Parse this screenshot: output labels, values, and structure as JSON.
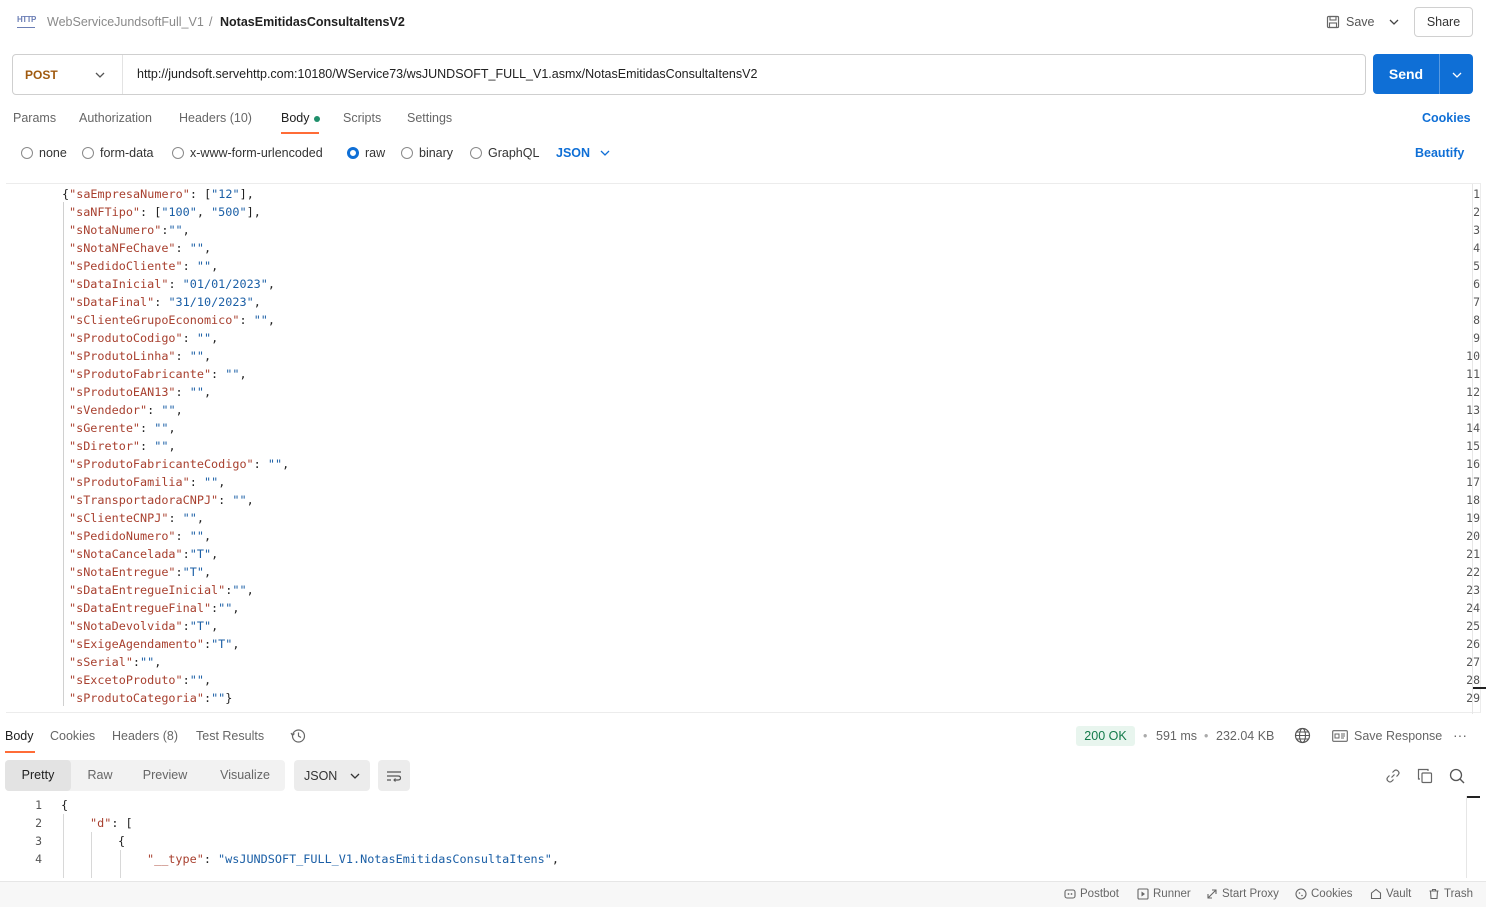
{
  "header": {
    "protocol_badge": "HTTP",
    "collection": "WebServiceJundsoftFull_V1",
    "separator": "/",
    "request_name": "NotasEmitidasConsultaItensV2",
    "save_label": "Save",
    "share_label": "Share"
  },
  "request": {
    "method": "POST",
    "url": "http://jundsoft.servehttp.com:10180/WService73/wsJUNDSOFT_FULL_V1.asmx/NotasEmitidasConsultaItensV2",
    "send_label": "Send",
    "tabs": [
      "Params",
      "Authorization",
      "Headers (10)",
      "Body",
      "Scripts",
      "Settings"
    ],
    "active_tab": "Body",
    "cookies_label": "Cookies",
    "body_types": [
      "none",
      "form-data",
      "x-www-form-urlencoded",
      "raw",
      "binary",
      "GraphQL"
    ],
    "selected_body_type": "raw",
    "raw_format": "JSON",
    "beautify_label": "Beautify"
  },
  "editor": {
    "lines": [
      [
        [
          "p",
          "{"
        ],
        [
          "k",
          "\"saEmpresaNumero\""
        ],
        [
          "p",
          ": ["
        ],
        [
          "s",
          "\"12\""
        ],
        [
          "p",
          "],"
        ]
      ],
      [
        [
          "k",
          "\"saNFTipo\""
        ],
        [
          "p",
          ": ["
        ],
        [
          "s",
          "\"100\""
        ],
        [
          "p",
          ", "
        ],
        [
          "s",
          "\"500\""
        ],
        [
          "p",
          "],"
        ]
      ],
      [
        [
          "k",
          "\"sNotaNumero\""
        ],
        [
          "p",
          ":"
        ],
        [
          "s",
          "\"\""
        ],
        [
          "p",
          ","
        ]
      ],
      [
        [
          "k",
          "\"sNotaNFeChave\""
        ],
        [
          "p",
          ": "
        ],
        [
          "s",
          "\"\""
        ],
        [
          "p",
          ","
        ]
      ],
      [
        [
          "k",
          "\"sPedidoCliente\""
        ],
        [
          "p",
          ": "
        ],
        [
          "s",
          "\"\""
        ],
        [
          "p",
          ","
        ]
      ],
      [
        [
          "k",
          "\"sDataInicial\""
        ],
        [
          "p",
          ": "
        ],
        [
          "s",
          "\"01/01/2023\""
        ],
        [
          "p",
          ","
        ]
      ],
      [
        [
          "k",
          "\"sDataFinal\""
        ],
        [
          "p",
          ": "
        ],
        [
          "s",
          "\"31/10/2023\""
        ],
        [
          "p",
          ","
        ]
      ],
      [
        [
          "k",
          "\"sClienteGrupoEconomico\""
        ],
        [
          "p",
          ": "
        ],
        [
          "s",
          "\"\""
        ],
        [
          "p",
          ","
        ]
      ],
      [
        [
          "k",
          "\"sProdutoCodigo\""
        ],
        [
          "p",
          ": "
        ],
        [
          "s",
          "\"\""
        ],
        [
          "p",
          ","
        ]
      ],
      [
        [
          "k",
          "\"sProdutoLinha\""
        ],
        [
          "p",
          ": "
        ],
        [
          "s",
          "\"\""
        ],
        [
          "p",
          ","
        ]
      ],
      [
        [
          "k",
          "\"sProdutoFabricante\""
        ],
        [
          "p",
          ": "
        ],
        [
          "s",
          "\"\""
        ],
        [
          "p",
          ","
        ]
      ],
      [
        [
          "k",
          "\"sProdutoEAN13\""
        ],
        [
          "p",
          ": "
        ],
        [
          "s",
          "\"\""
        ],
        [
          "p",
          ","
        ]
      ],
      [
        [
          "k",
          "\"sVendedor\""
        ],
        [
          "p",
          ": "
        ],
        [
          "s",
          "\"\""
        ],
        [
          "p",
          ","
        ]
      ],
      [
        [
          "k",
          "\"sGerente\""
        ],
        [
          "p",
          ": "
        ],
        [
          "s",
          "\"\""
        ],
        [
          "p",
          ","
        ]
      ],
      [
        [
          "k",
          "\"sDiretor\""
        ],
        [
          "p",
          ": "
        ],
        [
          "s",
          "\"\""
        ],
        [
          "p",
          ","
        ]
      ],
      [
        [
          "k",
          "\"sProdutoFabricanteCodigo\""
        ],
        [
          "p",
          ": "
        ],
        [
          "s",
          "\"\""
        ],
        [
          "p",
          ","
        ]
      ],
      [
        [
          "k",
          "\"sProdutoFamilia\""
        ],
        [
          "p",
          ": "
        ],
        [
          "s",
          "\"\""
        ],
        [
          "p",
          ","
        ]
      ],
      [
        [
          "k",
          "\"sTransportadoraCNPJ\""
        ],
        [
          "p",
          ": "
        ],
        [
          "s",
          "\"\""
        ],
        [
          "p",
          ","
        ]
      ],
      [
        [
          "k",
          "\"sClienteCNPJ\""
        ],
        [
          "p",
          ": "
        ],
        [
          "s",
          "\"\""
        ],
        [
          "p",
          ","
        ]
      ],
      [
        [
          "k",
          "\"sPedidoNumero\""
        ],
        [
          "p",
          ": "
        ],
        [
          "s",
          "\"\""
        ],
        [
          "p",
          ","
        ]
      ],
      [
        [
          "k",
          "\"sNotaCancelada\""
        ],
        [
          "p",
          ":"
        ],
        [
          "s",
          "\"T\""
        ],
        [
          "p",
          ","
        ]
      ],
      [
        [
          "k",
          "\"sNotaEntregue\""
        ],
        [
          "p",
          ":"
        ],
        [
          "s",
          "\"T\""
        ],
        [
          "p",
          ","
        ]
      ],
      [
        [
          "k",
          "\"sDataEntregueInicial\""
        ],
        [
          "p",
          ":"
        ],
        [
          "s",
          "\"\""
        ],
        [
          "p",
          ","
        ]
      ],
      [
        [
          "k",
          "\"sDataEntregueFinal\""
        ],
        [
          "p",
          ":"
        ],
        [
          "s",
          "\"\""
        ],
        [
          "p",
          ","
        ]
      ],
      [
        [
          "k",
          "\"sNotaDevolvida\""
        ],
        [
          "p",
          ":"
        ],
        [
          "s",
          "\"T\""
        ],
        [
          "p",
          ","
        ]
      ],
      [
        [
          "k",
          "\"sExigeAgendamento\""
        ],
        [
          "p",
          ":"
        ],
        [
          "s",
          "\"T\""
        ],
        [
          "p",
          ","
        ]
      ],
      [
        [
          "k",
          "\"sSerial\""
        ],
        [
          "p",
          ":"
        ],
        [
          "s",
          "\"\""
        ],
        [
          "p",
          ","
        ]
      ],
      [
        [
          "k",
          "\"sExcetoProduto\""
        ],
        [
          "p",
          ":"
        ],
        [
          "s",
          "\"\""
        ],
        [
          "p",
          ","
        ]
      ],
      [
        [
          "k",
          "\"sProdutoCategoria\""
        ],
        [
          "p",
          ":"
        ],
        [
          "s",
          "\"\""
        ],
        [
          "p",
          "}"
        ]
      ]
    ]
  },
  "response": {
    "tabs": [
      "Body",
      "Cookies",
      "Headers (8)",
      "Test Results"
    ],
    "active_tab": "Body",
    "status": "200 OK",
    "time": "591 ms",
    "size": "232.04 KB",
    "save_response_label": "Save Response",
    "view_modes": [
      "Pretty",
      "Raw",
      "Preview",
      "Visualize"
    ],
    "active_view": "Pretty",
    "format": "JSON",
    "lines": [
      {
        "n": "1",
        "indent": 0,
        "parts": [
          [
            "p",
            "{"
          ]
        ]
      },
      {
        "n": "2",
        "indent": 1,
        "parts": [
          [
            "k",
            "\"d\""
          ],
          [
            "p",
            ": ["
          ]
        ]
      },
      {
        "n": "3",
        "indent": 2,
        "parts": [
          [
            "p",
            "{"
          ]
        ]
      },
      {
        "n": "4",
        "indent": 3,
        "parts": [
          [
            "k",
            "\"__type\""
          ],
          [
            "p",
            ": "
          ],
          [
            "s",
            "\"wsJUNDSOFT_FULL_V1.NotasEmitidasConsultaItens\""
          ],
          [
            "p",
            ","
          ]
        ]
      }
    ]
  },
  "footer": {
    "items": [
      "Postbot",
      "Runner",
      "Start Proxy",
      "Cookies",
      "Vault",
      "Trash"
    ]
  },
  "colors": {
    "accent": "#0f6fd6",
    "method": "#a05a0f",
    "tab_underline": "#ff6c37",
    "status_ok": "#127a4a",
    "json_key": "#a8402f",
    "json_string": "#1b5fa6"
  }
}
